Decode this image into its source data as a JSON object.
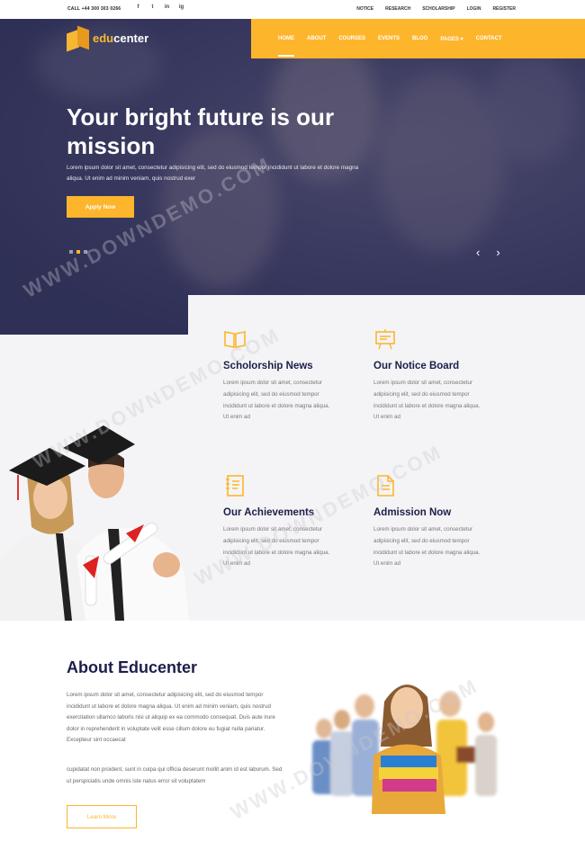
{
  "topbar": {
    "call": "CALL +44 300 303 0266",
    "social": [
      "f",
      "t",
      "in",
      "ig"
    ],
    "links": [
      "NOTICE",
      "RESEARCH",
      "SCHOLARSHIP",
      "LOGIN",
      "REGISTER"
    ]
  },
  "brand": {
    "prefix": "edu",
    "rest": "center"
  },
  "nav": {
    "items": [
      "HOME",
      "ABOUT",
      "COURSES",
      "EVENTS",
      "BLOG",
      "PAGES ▾",
      "CONTACT"
    ]
  },
  "hero": {
    "title": "Your bright future is our mission",
    "text": "Lorem ipsum dolor sit amet, consectetur adipisicing elit, sed do eiusmod tempor incididunt ut labore et dolore magna aliqua. Ut enim ad minim veniam, quis nostrud exer",
    "button": "Apply Now",
    "prev_arrow": "‹",
    "next_arrow": "›"
  },
  "features": [
    {
      "icon": "book-icon",
      "title": "Scholorship News",
      "text": "Lorem ipsum dolor sit amet, consectetur adipisicing elit, sed do eiusmod tempor incididunt ut labore et dolore magna aliqua. Ut enim ad"
    },
    {
      "icon": "notice-board-icon",
      "title": "Our Notice Board",
      "text": "Lorem ipsum dolor sit amet, consectetur adipisicing elit, sed do eiusmod tempor incididunt ut labore et dolore magna aliqua. Ut enim ad"
    },
    {
      "icon": "notebook-icon",
      "title": "Our Achievements",
      "text": "Lorem ipsum dolor sit amet, consectetur adipisicing elit, sed do eiusmod tempor incididunt ut labore et dolore magna aliqua. Ut enim ad"
    },
    {
      "icon": "document-icon",
      "title": "Admission Now",
      "text": "Lorem ipsum dolor sit amet, consectetur adipisicing elit, sed do eiusmod tempor incididunt ut labore et dolore magna aliqua. Ut enim ad"
    }
  ],
  "about": {
    "title": "About Educenter",
    "p1": "Lorem ipsum dolor sit amet, consectetur adipisicing elit, sed do eiusmod tempor incididunt ut labore et dolore magna aliqua. Ut enim ad minim veniam, quis nostrud exercitation ullamco laboris nisi ut aliquip ex ea commodo consequat. Duis aute irure dolor in reprehenderit in voluptate velit esse cillum dolore eu fugiat nulla pariatur. Excepteur sint occaecat",
    "p2": "cupidatat non proident, sunt in culpa qui officia deserunt mollit anim id est laborum. Sed ut perspiciatis unde omnis iste natus error sit voluptatem",
    "button": "Learn More"
  },
  "watermark": "WWW.DOWNDEMO.COM",
  "colors": {
    "accent": "#fdb52c",
    "heading": "#1c1e4a",
    "hero": "#3a3a5e"
  }
}
